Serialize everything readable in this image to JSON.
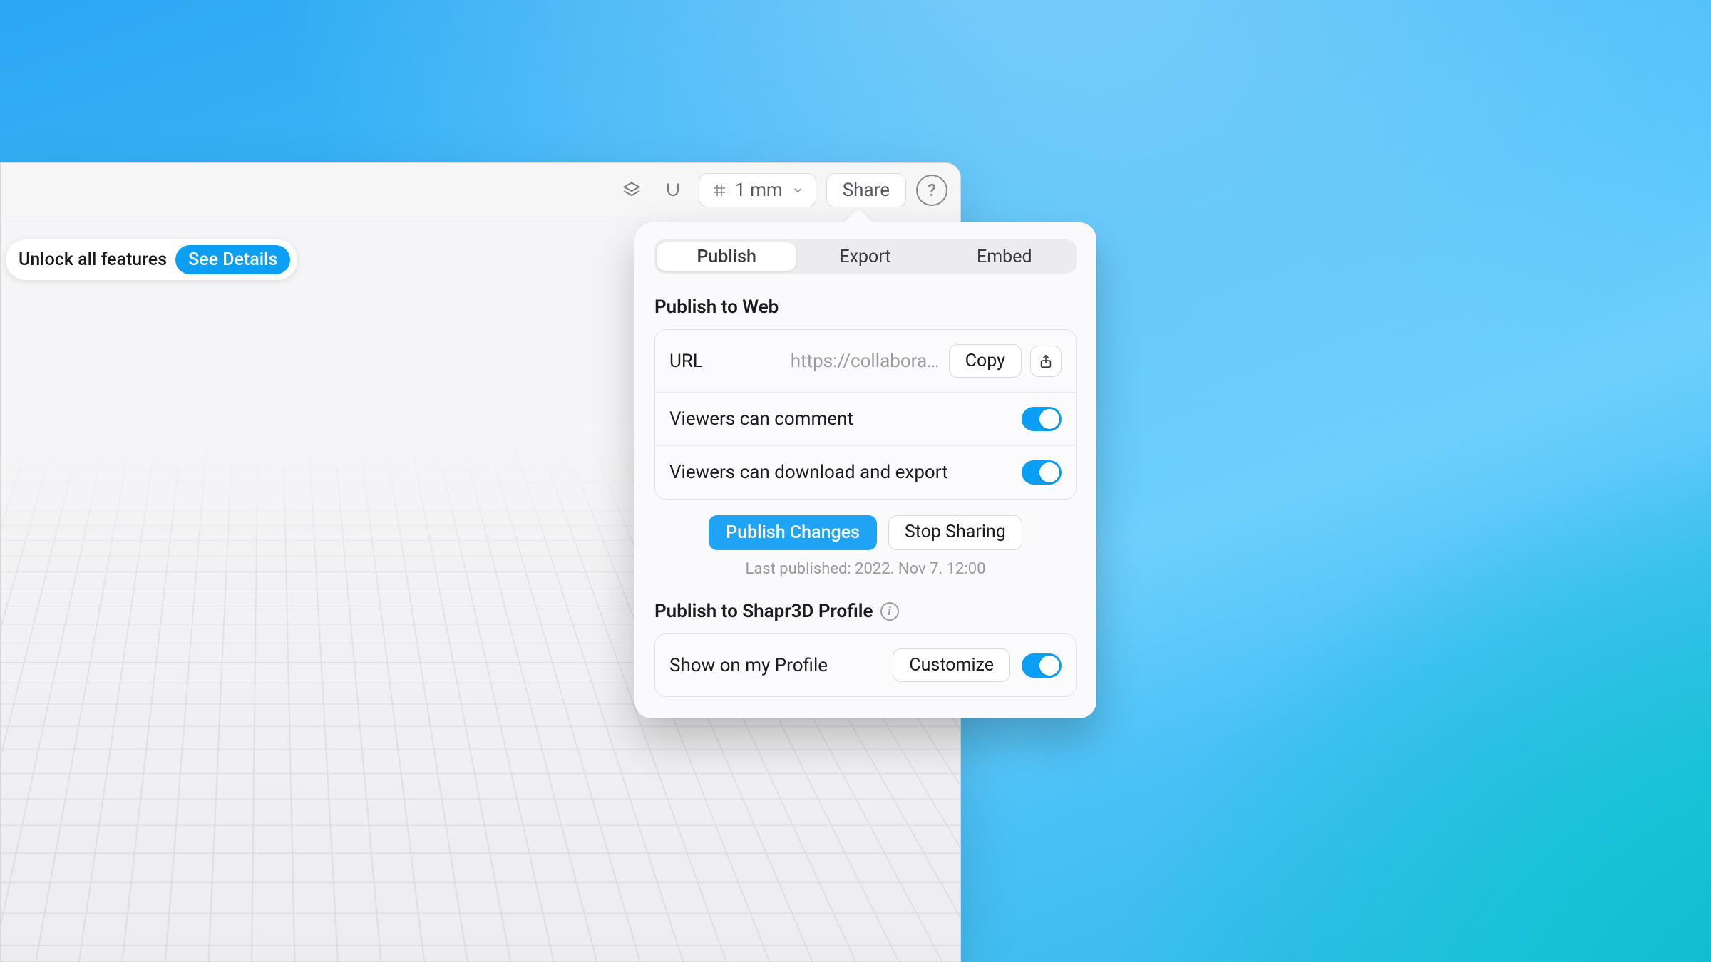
{
  "toolbar": {
    "grid_value": "1 mm",
    "share_label": "Share"
  },
  "unlock": {
    "text": "Unlock all features",
    "button": "See Details"
  },
  "popover": {
    "tabs": {
      "publish": "Publish",
      "export": "Export",
      "embed": "Embed"
    },
    "publishWeb": {
      "title": "Publish to Web",
      "urlLabel": "URL",
      "urlValue": "https://collaborat…",
      "copy": "Copy",
      "commentLabel": "Viewers can comment",
      "downloadLabel": "Viewers can download and export",
      "publishChanges": "Publish Changes",
      "stopSharing": "Stop Sharing",
      "lastPublished": "Last published: 2022. Nov 7. 12:00"
    },
    "publishProfile": {
      "title": "Publish to Shapr3D Profile",
      "showLabel": "Show on my Profile",
      "customize": "Customize"
    }
  }
}
